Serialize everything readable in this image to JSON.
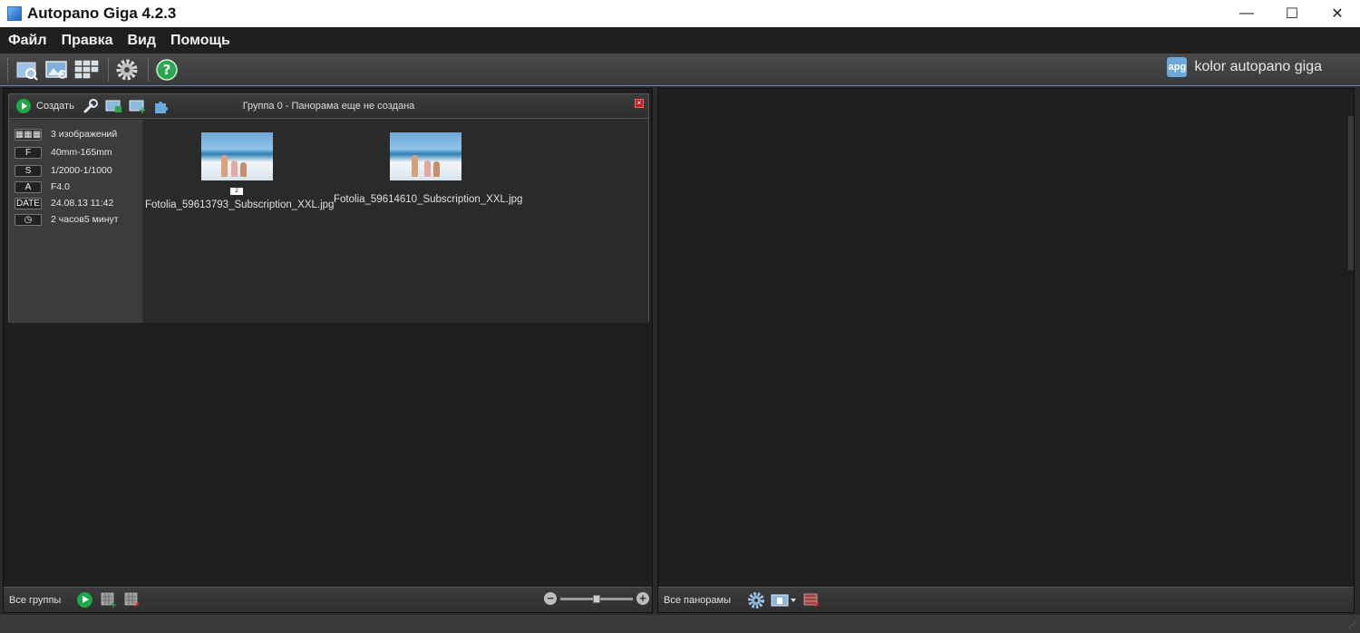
{
  "window": {
    "title": "Autopano Giga 4.2.3",
    "minimize": "—",
    "maximize": "☐",
    "close": "✕"
  },
  "menu": [
    "Файл",
    "Правка",
    "Вид",
    "Помощь"
  ],
  "toolbar": {
    "icons": [
      "open-folder-icon",
      "import-images-icon",
      "detect-grid-icon",
      "settings-gear-icon",
      "help-icon"
    ],
    "brand_badge": "apg",
    "brand_text": "kolor autopano giga"
  },
  "group": {
    "create_label": "Создать",
    "title": "Группа 0 - Панорама еще не создана",
    "close": "×",
    "info": [
      {
        "tag": "▦▦▦",
        "value": "3 изображений"
      },
      {
        "tag": "F",
        "value": "40mm-165mm"
      },
      {
        "tag": "S",
        "value": "1/2000-1/1000"
      },
      {
        "tag": "A",
        "value": "F4.0"
      },
      {
        "tag": "DATE",
        "value": "24.08.13 11:42"
      },
      {
        "tag": "◷",
        "value": "2 часов5 минут"
      }
    ],
    "images": [
      {
        "name": "Fotolia_59613793_Subscription_XXL.jpg",
        "badge": "2"
      },
      {
        "name": "Fotolia_59614610_Subscription_XXL.jpg",
        "badge": ""
      }
    ]
  },
  "left_bottom": {
    "label": "Все группы",
    "zoom_minus": "−",
    "zoom_plus": "+",
    "zoom_level": 0.5
  },
  "right_bottom": {
    "label": "Все панорамы"
  },
  "colors": {
    "accent_green": "#1fa84a",
    "panel_bg": "#1f1f1f",
    "toolbar_border": "#5a87b8"
  }
}
